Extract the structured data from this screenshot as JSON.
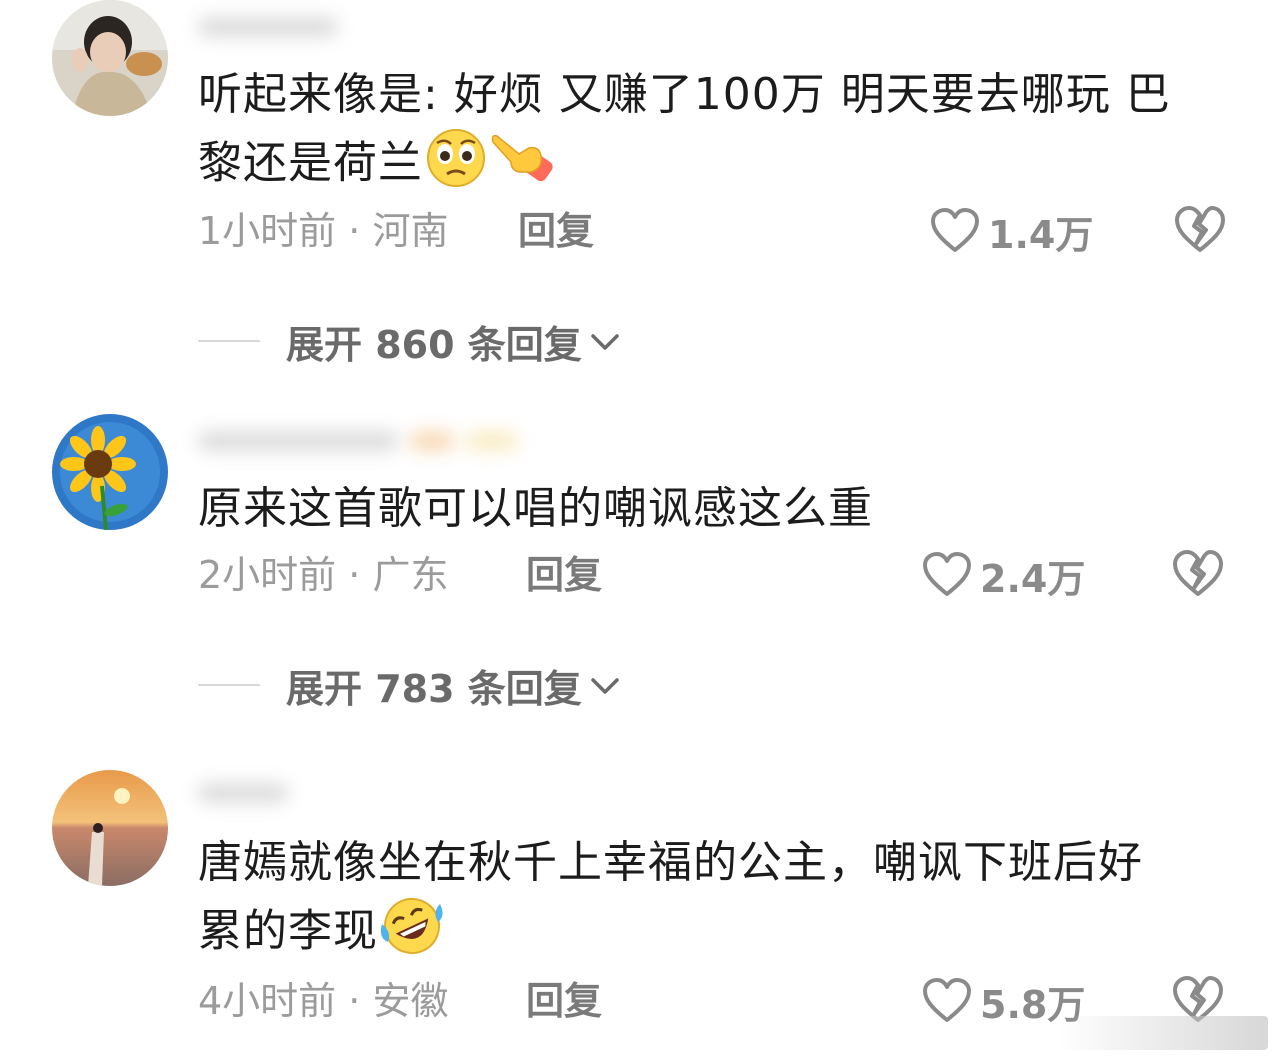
{
  "comments": [
    {
      "text_line1": "听起来像是: 好烦 又赚了100万 明天要去哪玩 巴",
      "text_line2": "黎还是荷兰",
      "time": "1小时前",
      "sep": "·",
      "location": "河南",
      "reply_label": "回复",
      "likes": "1.4万",
      "expand_label": "展开 860 条回复",
      "emojis": [
        "pleading-face",
        "pointing-hand"
      ]
    },
    {
      "text_line1": "原来这首歌可以唱的嘲讽感这么重",
      "time": "2小时前",
      "sep": "·",
      "location": "广东",
      "reply_label": "回复",
      "likes": "2.4万",
      "expand_label": "展开 783 条回复"
    },
    {
      "text_line1": "唐嫣就像坐在秋千上幸福的公主，嘲讽下班后好",
      "text_line2": "累的李现",
      "time": "4小时前",
      "sep": "·",
      "location": "安徽",
      "reply_label": "回复",
      "likes": "5.8万",
      "emojis": [
        "rolling-laughing-face"
      ]
    }
  ],
  "colors": {
    "text": "#1c1c1c",
    "meta": "#9b9b9b",
    "icon": "#8a8a8a"
  }
}
